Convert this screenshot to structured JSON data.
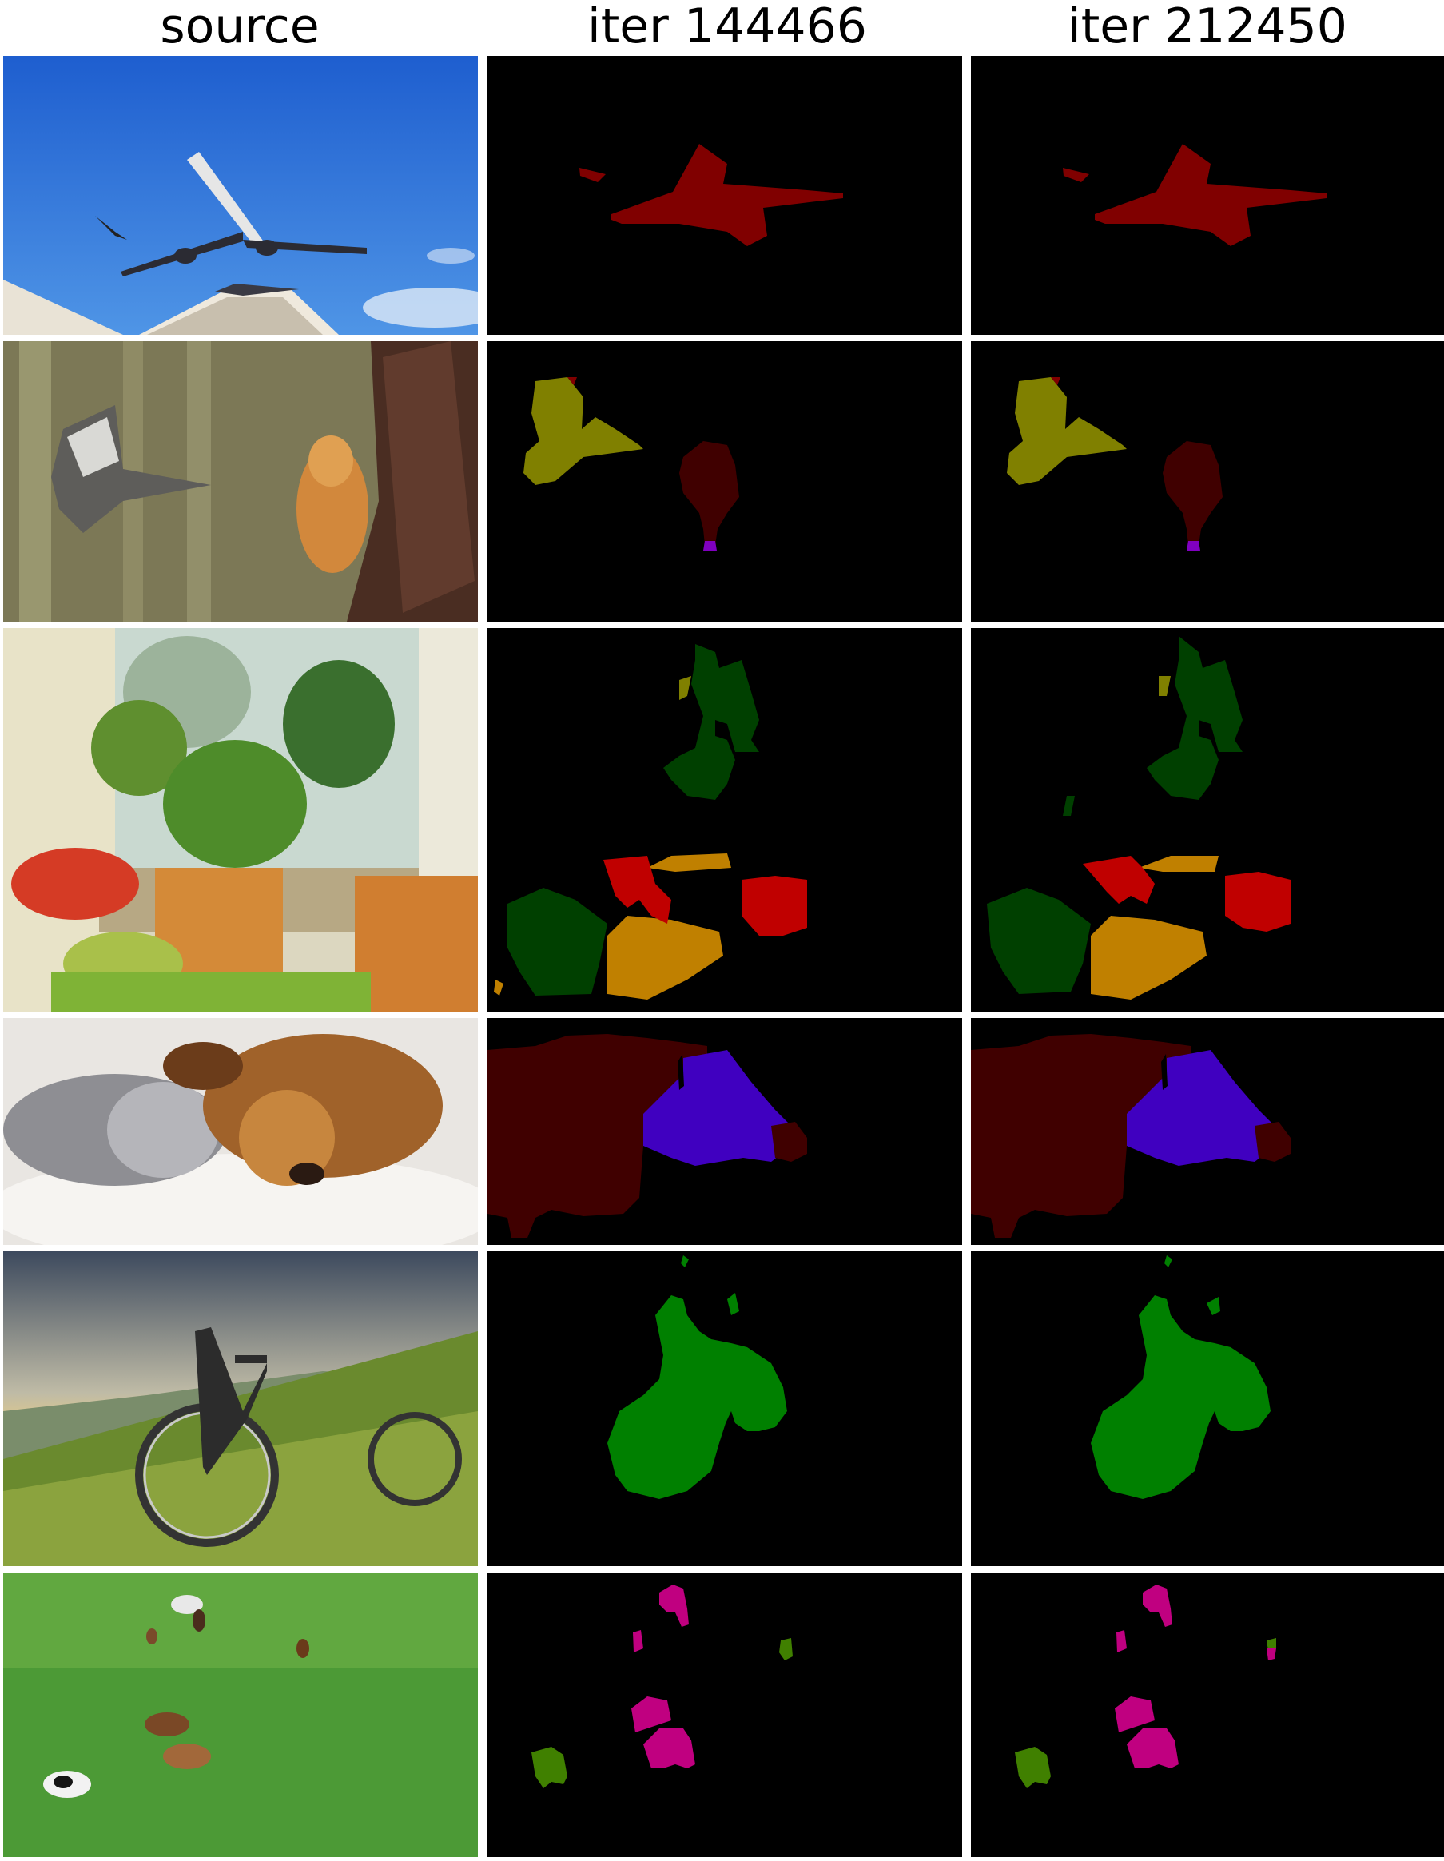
{
  "headers": {
    "source": "source",
    "iter_a": "iter 144466",
    "iter_b": "iter 212450"
  },
  "rows": [
    {
      "id": "airplane",
      "classes": [
        "aeroplane",
        "bird"
      ]
    },
    {
      "id": "bird-cat",
      "classes": [
        "bird",
        "cat",
        "person"
      ]
    },
    {
      "id": "table",
      "classes": [
        "pottedplant",
        "chair",
        "diningtable"
      ]
    },
    {
      "id": "cat-dog",
      "classes": [
        "cat",
        "dog"
      ]
    },
    {
      "id": "bicycle",
      "classes": [
        "bicycle"
      ]
    },
    {
      "id": "horses",
      "classes": [
        "horse",
        "cow",
        "sheep"
      ]
    }
  ],
  "palette": {
    "aeroplane": "#800000",
    "bird": "#808000",
    "cat": "#400000",
    "person": "#8000c0",
    "pottedplant": "#004000",
    "chair": "#c08000",
    "diningtable": "#c00000",
    "dog": "#4000c0",
    "bicycle": "#008000",
    "horse": "#c00080",
    "cow": "#408000"
  }
}
